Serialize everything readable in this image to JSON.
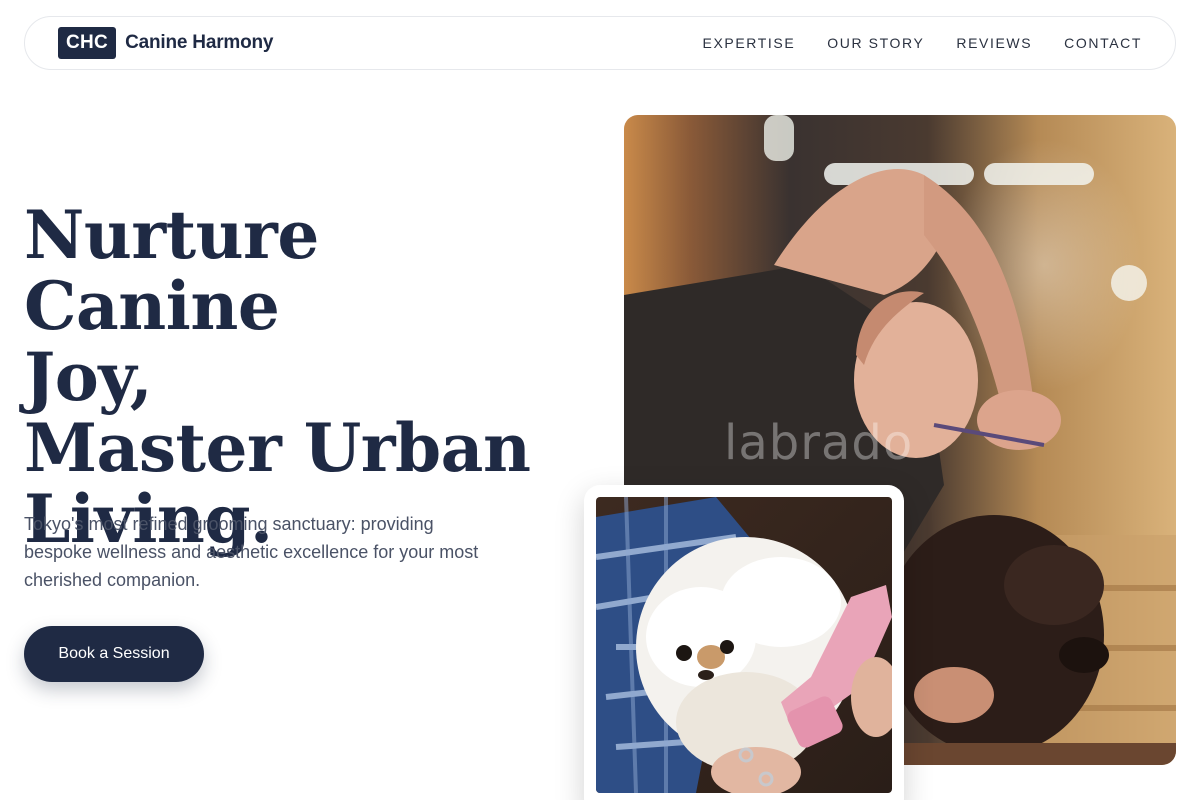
{
  "brand": {
    "mark": "CHC",
    "name": "Canine Harmony"
  },
  "nav": {
    "items": [
      "EXPERTISE",
      "OUR STORY",
      "REVIEWS",
      "CONTACT"
    ]
  },
  "hero": {
    "headline_lines": [
      "Nurture Canine",
      "Joy,",
      "Master Urban",
      "Living."
    ],
    "lede": "Tokyo's most refined grooming sanctuary: providing bespoke wellness and aesthetic excellence for your most cherished companion.",
    "cta_label": "Book a Session"
  },
  "images": {
    "main": {
      "watermark": "labrado"
    },
    "inset": {}
  },
  "colors": {
    "primary": "#1f2a44",
    "text_muted": "#4a5266",
    "border": "#e6e8ec"
  }
}
